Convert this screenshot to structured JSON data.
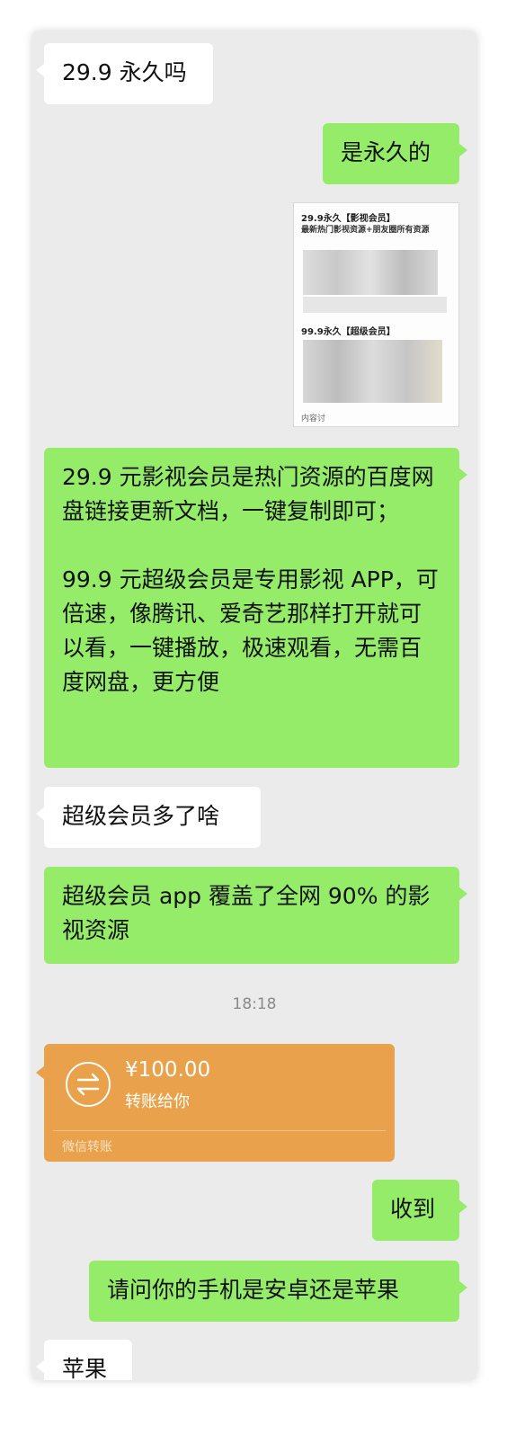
{
  "messages": [
    {
      "side": "left",
      "text": "29.9 永久吗"
    },
    {
      "side": "right",
      "text": "是永久的"
    },
    {
      "side": "right",
      "text": "29.9 元影视会员是热门资源的百度网盘链接更新文档，一键复制即可；\n\n99.9 元超级会员是专用影视 APP，可倍速，像腾讯、爱奇艺那样打开就可以看，一键播放，极速观看，无需百度网盘，更方便"
    },
    {
      "side": "left",
      "text": "超级会员多了啥"
    },
    {
      "side": "right",
      "text": "超级会员 app 覆盖了全网 90% 的影视资源"
    },
    {
      "side": "right",
      "text": "收到"
    },
    {
      "side": "right",
      "text": "请问你的手机是安卓还是苹果"
    },
    {
      "side": "left",
      "text": "苹果"
    }
  ],
  "image_message": {
    "line1": "29.9永久【影视会员】",
    "line2": "最新热门影视资源+朋友圈所有资源",
    "line3": "99.9永久【超级会员】",
    "line4": "内容讨"
  },
  "timestamp": "18:18",
  "transfer": {
    "amount": "¥100.00",
    "desc": "转账给你",
    "footer": "微信转账",
    "icon": "transfer-arrows-icon",
    "color": "#e9a24b"
  },
  "colors": {
    "incoming": "#ffffff",
    "outgoing": "#95ec69",
    "background": "#ebebeb"
  }
}
